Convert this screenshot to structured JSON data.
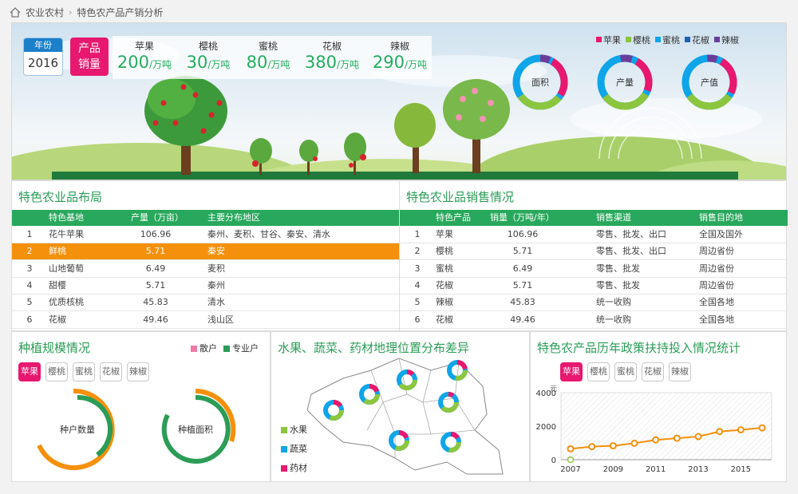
{
  "breadcrumb": {
    "root": "农业农村",
    "current": "特色农产品产销分析"
  },
  "hero": {
    "year_label": "年份",
    "year_value": "2016",
    "production_label_1": "产品",
    "production_label_2": "销量",
    "products": [
      {
        "name": "苹果",
        "value": "200",
        "unit": "/万吨"
      },
      {
        "name": "樱桃",
        "value": "30",
        "unit": "/万吨"
      },
      {
        "name": "蜜桃",
        "value": "80",
        "unit": "/万吨"
      },
      {
        "name": "花椒",
        "value": "380",
        "unit": "/万吨"
      },
      {
        "name": "辣椒",
        "value": "290",
        "unit": "/万吨"
      }
    ],
    "legend": [
      "苹果",
      "樱桃",
      "蜜桃",
      "花椒",
      "辣椒"
    ],
    "donuts": [
      "面积",
      "产量",
      "产值"
    ]
  },
  "colors": {
    "apple": "#e8176f",
    "cherry": "#8cc63f",
    "peach": "#0ea5e9",
    "pepper": "#1f5fb8",
    "chili": "#6a3d9a",
    "green": "#2c9c57",
    "orange": "#f4900c"
  },
  "layout_table": {
    "title": "特色农业品布局",
    "headers": [
      "特色基地",
      "产量（万亩）",
      "主要分布地区"
    ],
    "rows": [
      {
        "no": "1",
        "name": "花牛苹果",
        "value": "106.96",
        "area": "秦州、麦积、甘谷、秦安、清水"
      },
      {
        "no": "2",
        "name": "鲜桃",
        "value": "5.71",
        "area": "秦安"
      },
      {
        "no": "3",
        "name": "山地葡萄",
        "value": "6.49",
        "area": "麦积"
      },
      {
        "no": "4",
        "name": "甜樱",
        "value": "5.71",
        "area": "秦州"
      },
      {
        "no": "5",
        "name": "优质核桃",
        "value": "45.83",
        "area": "清水"
      },
      {
        "no": "6",
        "name": "花椒",
        "value": "49.46",
        "area": "浅山区"
      }
    ]
  },
  "sales_table": {
    "title": "特色农业品销售情况",
    "headers": [
      "特色产品",
      "销量（万吨/年）",
      "销售渠道",
      "销售目的地"
    ],
    "rows": [
      {
        "no": "1",
        "name": "苹果",
        "value": "106.96",
        "channel": "零售、批发、出口",
        "dest": "全国及国外"
      },
      {
        "no": "2",
        "name": "樱桃",
        "value": "5.71",
        "channel": "零售、批发、出口",
        "dest": "周边省份"
      },
      {
        "no": "3",
        "name": "蜜桃",
        "value": "6.49",
        "channel": "零售、批发",
        "dest": "周边省份"
      },
      {
        "no": "4",
        "name": "花椒",
        "value": "5.71",
        "channel": "零售、批发",
        "dest": "周边省份"
      },
      {
        "no": "5",
        "name": "辣椒",
        "value": "45.83",
        "channel": "统一收购",
        "dest": "全国各地"
      },
      {
        "no": "6",
        "name": "花椒",
        "value": "49.46",
        "channel": "统一收购",
        "dest": "全国各地"
      }
    ]
  },
  "scale": {
    "title": "种植规模情况",
    "legend": [
      "散户",
      "专业户"
    ],
    "tabs": [
      "苹果",
      "樱桃",
      "蜜桃",
      "花椒",
      "辣椒"
    ],
    "gauges": [
      "种户数量",
      "种植面积"
    ]
  },
  "geo": {
    "title": "水果、蔬菜、药材地理位置分布差异",
    "legend": [
      "水果",
      "蔬菜",
      "药材"
    ]
  },
  "policy": {
    "title": "特色农产品历年政策扶持投入情况统计",
    "tabs": [
      "苹果",
      "樱桃",
      "蜜桃",
      "花椒",
      "辣椒"
    ]
  },
  "chart_data": {
    "type": "line",
    "title": "",
    "ylabel": "元",
    "x": [
      2007,
      2008,
      2009,
      2010,
      2011,
      2012,
      2013,
      2014,
      2015,
      2016
    ],
    "x_tick_labels": [
      "2007",
      "2009",
      "2011",
      "2013",
      "2015"
    ],
    "y_tick_labels": [
      "4000",
      "2000",
      "0"
    ],
    "ylim": [
      0,
      4000
    ],
    "series": [
      {
        "values": [
          650,
          780,
          830,
          980,
          1180,
          1280,
          1380,
          1680,
          1780,
          1900
        ]
      }
    ]
  }
}
